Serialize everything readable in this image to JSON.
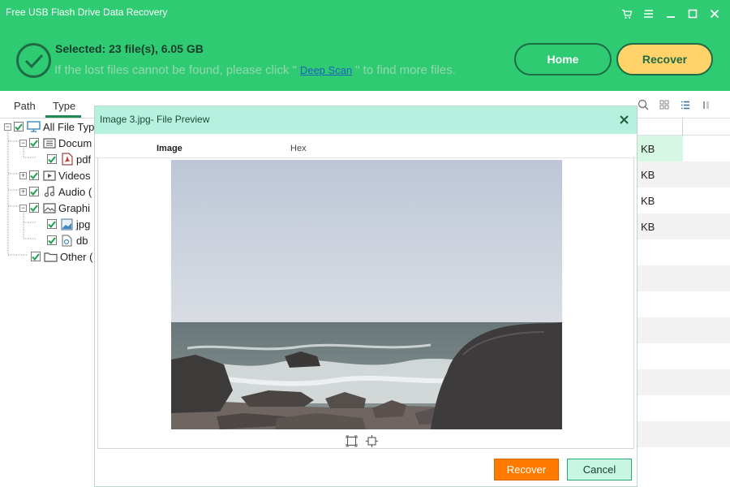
{
  "app": {
    "title": "Free USB Flash Drive Data Recovery"
  },
  "window_controls": [
    {
      "name": "cart-icon"
    },
    {
      "name": "menu-icon"
    },
    {
      "name": "minimize-icon"
    },
    {
      "name": "maximize-icon"
    },
    {
      "name": "close-icon"
    }
  ],
  "status": {
    "selected": "Selected: 23 file(s), 6.05 GB",
    "hint_before": "If the lost files cannot be found, please click \"",
    "deep_scan": "Deep Scan",
    "hint_after": "\" to find more files."
  },
  "actions": {
    "home": "Home",
    "recover": "Recover"
  },
  "left_tabs": {
    "path": "Path",
    "type": "Type",
    "active": "Type"
  },
  "tree": [
    {
      "id": "all",
      "label": "All File Typ",
      "icon": "monitor-icon",
      "checked": true,
      "expander": "minus"
    },
    {
      "id": "documents",
      "label": "Docum",
      "icon": "document-icon",
      "checked": true,
      "expander": "minus"
    },
    {
      "id": "pdf",
      "label": "pdf",
      "icon": "pdf-icon",
      "checked": true,
      "expander": ""
    },
    {
      "id": "videos",
      "label": "Videos",
      "icon": "video-icon",
      "checked": true,
      "expander": "plus"
    },
    {
      "id": "audio",
      "label": "Audio (",
      "icon": "music-icon",
      "checked": true,
      "expander": "plus"
    },
    {
      "id": "graphics",
      "label": "Graphi",
      "icon": "image-icon",
      "checked": true,
      "expander": "minus"
    },
    {
      "id": "jpg",
      "label": "jpg",
      "icon": "jpg-icon",
      "checked": true,
      "expander": ""
    },
    {
      "id": "db",
      "label": "db",
      "icon": "db-icon",
      "checked": true,
      "expander": ""
    },
    {
      "id": "other",
      "label": "Other (",
      "icon": "folder-icon",
      "checked": true,
      "expander": ""
    }
  ],
  "view_toolbar": [
    {
      "name": "search-icon"
    },
    {
      "name": "grid-view-icon"
    },
    {
      "name": "list-view-icon"
    },
    {
      "name": "detail-view-icon"
    }
  ],
  "file_list": {
    "rows": [
      "KB",
      "KB",
      "KB",
      "KB"
    ]
  },
  "dialog": {
    "title": "Image 3.jpg- File Preview",
    "tabs": {
      "image": "Image",
      "hex": "Hex"
    },
    "recover": "Recover",
    "cancel": "Cancel",
    "zoom_controls": [
      {
        "name": "fit-to-window-icon"
      },
      {
        "name": "actual-size-icon"
      }
    ]
  },
  "colors": {
    "header": "#2ecb73",
    "accent_yellow": "#ffd36a",
    "dialog_title_bg": "#b6f1df",
    "recover_orange": "#ff7b00"
  }
}
